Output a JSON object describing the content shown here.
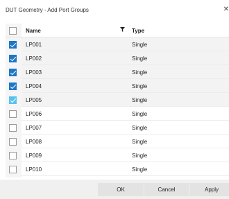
{
  "dialog": {
    "title": "DUT Geometry - Add Port Groups",
    "close_glyph": "✕"
  },
  "grid": {
    "columns": {
      "name": "Name",
      "type": "Type"
    },
    "filter_icon": "filter-icon",
    "rows": [
      {
        "name": "LP001",
        "type": "Single",
        "checked": true
      },
      {
        "name": "LP002",
        "type": "Single",
        "checked": true
      },
      {
        "name": "LP003",
        "type": "Single",
        "checked": true
      },
      {
        "name": "LP004",
        "type": "Single",
        "checked": true
      },
      {
        "name": "LP005",
        "type": "Single",
        "checked": true
      },
      {
        "name": "LP006",
        "type": "Single",
        "checked": false
      },
      {
        "name": "LP007",
        "type": "Single",
        "checked": false
      },
      {
        "name": "LP008",
        "type": "Single",
        "checked": false
      },
      {
        "name": "LP009",
        "type": "Single",
        "checked": false
      },
      {
        "name": "LP010",
        "type": "Single",
        "checked": false
      }
    ]
  },
  "buttons": {
    "ok": "OK",
    "cancel": "Cancel",
    "apply": "Apply"
  },
  "colors": {
    "check_accent": "#1e77c6",
    "check_hover": "#58c2ee",
    "footer_bg": "#f0f0f0"
  }
}
